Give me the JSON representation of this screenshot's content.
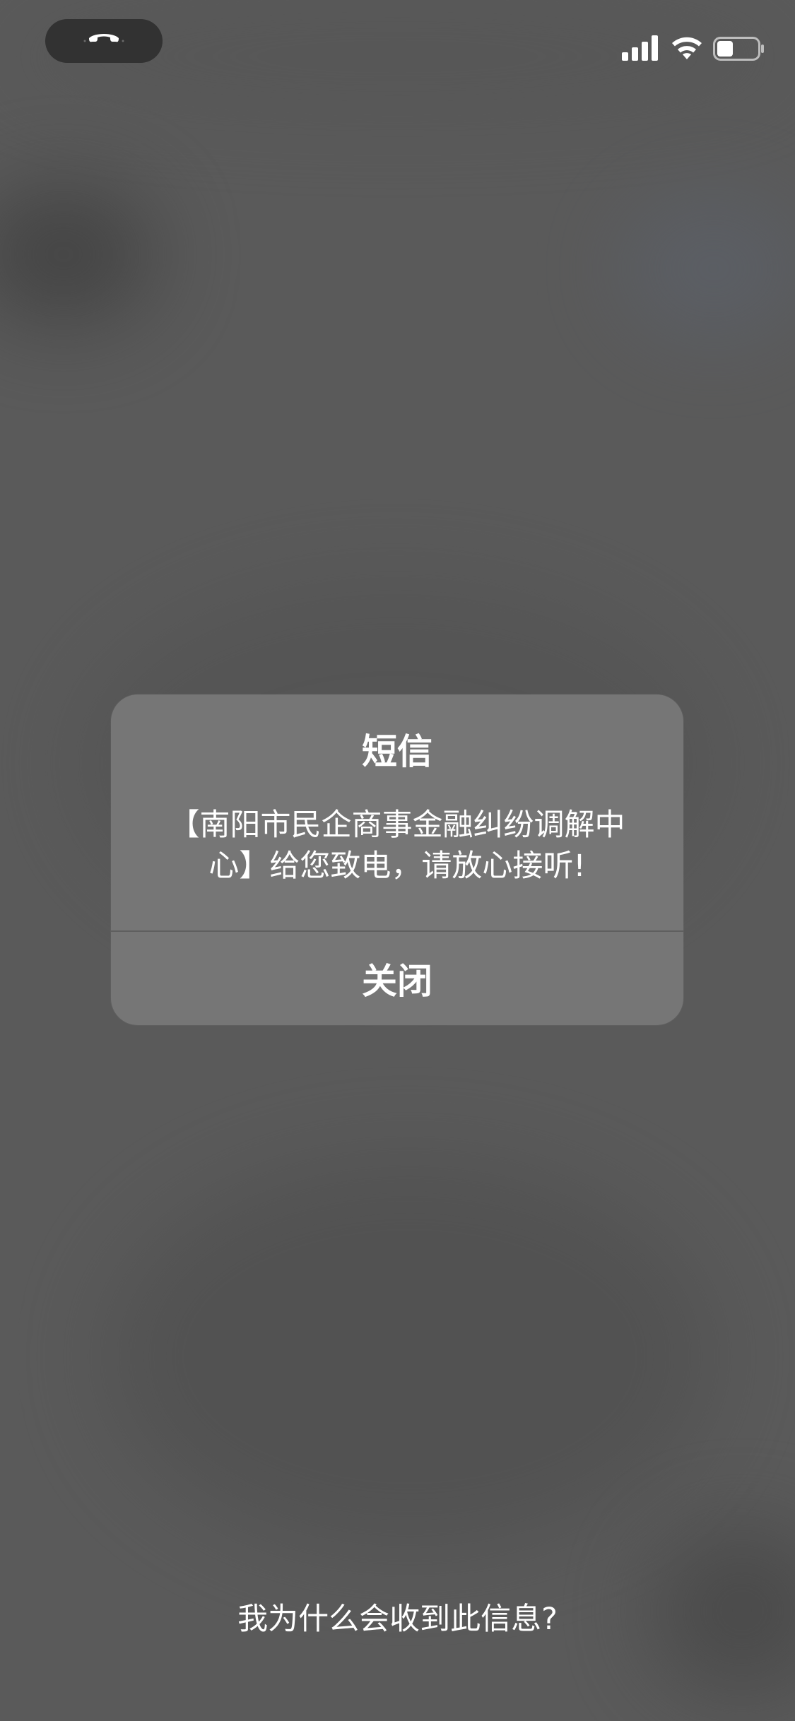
{
  "status_bar": {
    "call_icon": "phone-hangup-icon",
    "signal_icon": "cellular-signal-icon",
    "wifi_icon": "wifi-icon",
    "battery_icon": "battery-icon",
    "battery_level": 0.4
  },
  "alert": {
    "title": "短信",
    "message_line_1": "【南阳市民企商事金融纠纷调解中",
    "message_line_2": "心】给您致电，请放心接听!",
    "close_label": "关闭"
  },
  "footer": {
    "why_label": "我为什么会收到此信息?"
  },
  "colors": {
    "background": "#5a5a5a",
    "alert_background": "#767676",
    "text": "#ffffff"
  }
}
